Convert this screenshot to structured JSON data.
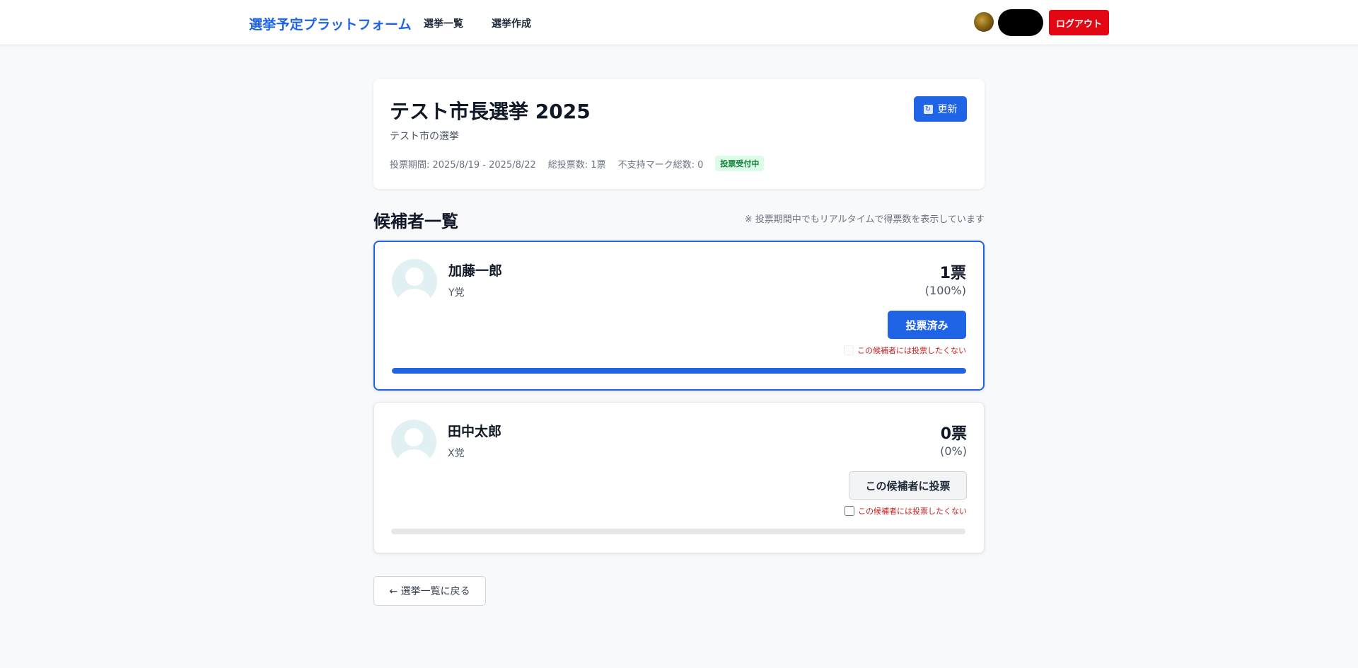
{
  "header": {
    "brand": "選挙予定プラットフォーム",
    "nav": [
      {
        "label": "選挙一覧"
      },
      {
        "label": "選挙作成"
      }
    ],
    "user_name": "",
    "logout_label": "ログアウト"
  },
  "election": {
    "title": "テスト市長選挙 2025",
    "description": "テスト市の選挙",
    "period": "投票期間: 2025/8/19 - 2025/8/22",
    "total_votes": "総投票数: 1票",
    "disapproval_total": "不支持マーク総数: 0",
    "status": "投票受付中",
    "refresh_label": "更新"
  },
  "candidates_section": {
    "title": "候補者一覧",
    "note": "※ 投票期間中でもリアルタイムで得票数を表示しています"
  },
  "candidates": [
    {
      "name": "加藤一郎",
      "party": "Y党",
      "votes": "1票",
      "percent": "(100%)",
      "share": 1.0,
      "button_label": "投票済み",
      "voted": true,
      "no_vote_label": "この候補者には投票したくない"
    },
    {
      "name": "田中太郎",
      "party": "X党",
      "votes": "0票",
      "percent": "(0%)",
      "share": 0.0,
      "button_label": "この候補者に投票",
      "voted": false,
      "no_vote_label": "この候補者には投票したくない"
    }
  ],
  "back_label": "← 選挙一覧に戻る",
  "colors": {
    "accent": "#1f63e6",
    "logout": "#e30613",
    "status_bg": "#dcfce7",
    "status_text": "#15803d",
    "warning_text": "#c81e1e"
  }
}
